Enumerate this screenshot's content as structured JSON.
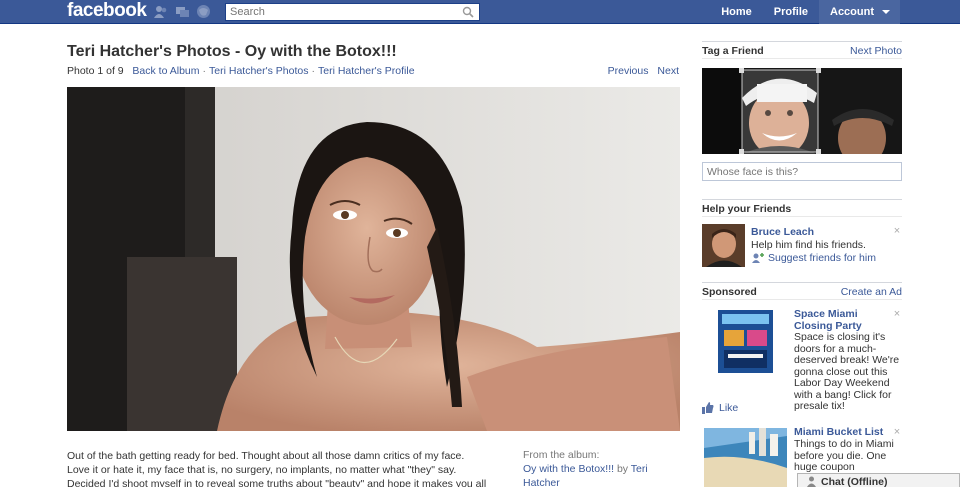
{
  "topbar": {
    "logo": "facebook",
    "search_placeholder": "Search",
    "nav": {
      "home": "Home",
      "profile": "Profile",
      "account": "Account"
    },
    "icons": [
      "friend-requests-icon",
      "messages-icon",
      "notifications-icon",
      "search-icon",
      "chevron-down-icon"
    ]
  },
  "photo_page": {
    "title": "Teri Hatcher's Photos - Oy with the Botox!!!",
    "counter": "Photo 1 of 9",
    "back_to_album": "Back to Album",
    "owner_photos": "Teri Hatcher's Photos",
    "owner_profile": "Teri Hatcher's Profile",
    "previous": "Previous",
    "next": "Next",
    "separator": "·",
    "caption": "Out of the bath getting ready for bed. Thought about all those damn critics of my face. Love it or hate it, my face that is, no surgery, no implants, no matter what \"they\" say. Decided I'd shoot myself in to reveal some truths about \"beauty\" and hope it makes you all",
    "from_album_label": "From the album:",
    "album_name": "Oy with the Botox!!!",
    "album_by": "by",
    "album_owner": "Teri Hatcher"
  },
  "sidebar": {
    "tag_header": "Tag a Friend",
    "next_photo": "Next Photo",
    "whose_placeholder": "Whose face is this?",
    "help_header": "Help your Friends",
    "friend": {
      "name": "Bruce Leach",
      "help_text": "Help him find his friends.",
      "suggest": "Suggest friends for him"
    },
    "sponsored_header": "Sponsored",
    "create_ad": "Create an Ad",
    "ad1": {
      "title": "Space Miami Closing Party",
      "body": "Space is closing it's doors for a much-deserved break! We're gonna close out this Labor Day Weekend with a bang! Click for presale tix!",
      "like": "Like"
    },
    "ad2": {
      "title": "Miami Bucket List",
      "body": "Things to do in Miami before you die. One huge coupon"
    },
    "close_glyph": "×"
  },
  "chat": {
    "label": "Chat (Offline)"
  },
  "colors": {
    "brand": "#3b5998",
    "link": "#3b5998",
    "text": "#333333"
  }
}
